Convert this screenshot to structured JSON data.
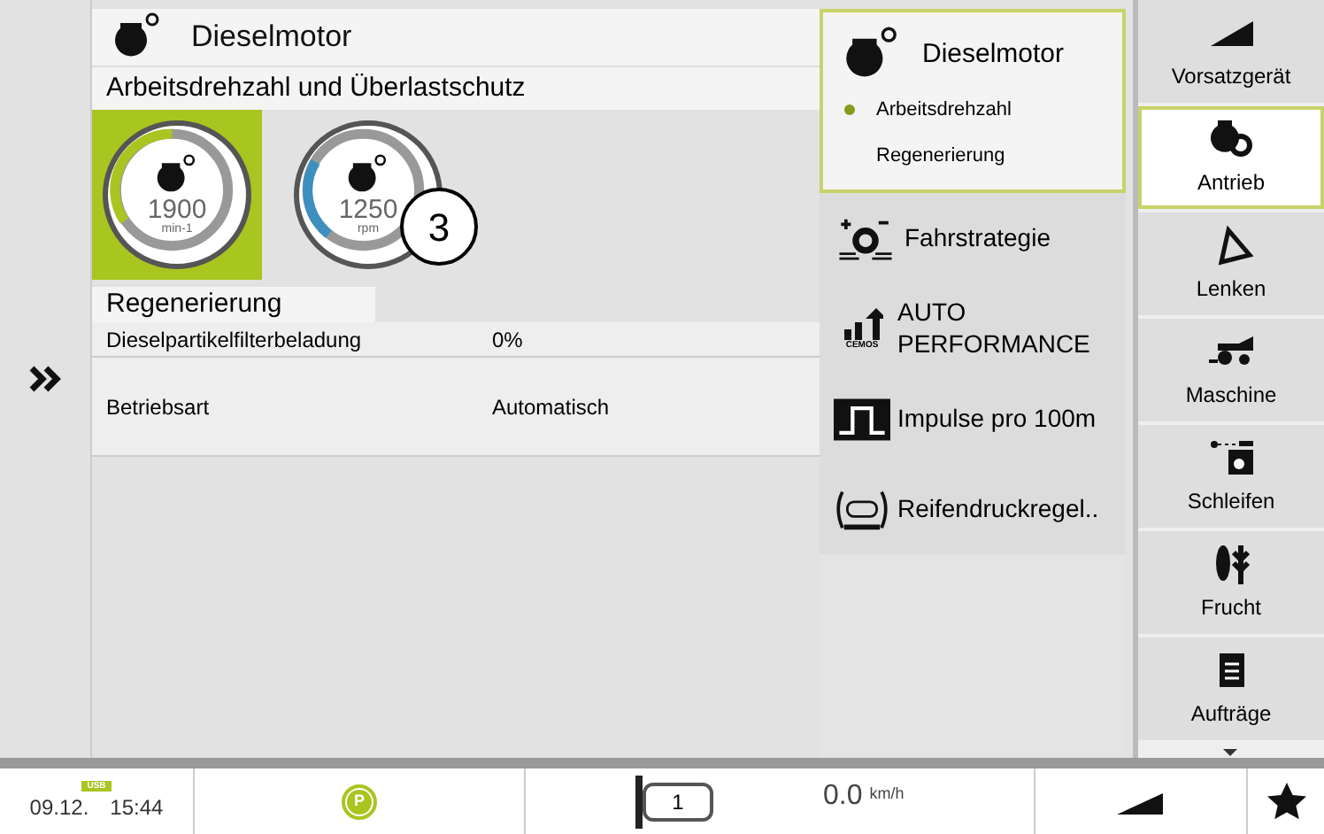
{
  "header": {
    "title": "Dieselmotor"
  },
  "section": {
    "title": "Arbeitsdrehzahl und Überlastschutz"
  },
  "dials": [
    {
      "kind": "work",
      "value": "1900",
      "unit": "min-1",
      "selected": true
    },
    {
      "kind": "overload",
      "value": "1250",
      "unit": "rpm",
      "selected": false
    }
  ],
  "callout": "3",
  "regeneration": {
    "title": "Regenerierung",
    "rows": [
      {
        "label": "Dieselpartikelfilterbeladung",
        "value": "0%",
        "kind": "short"
      },
      {
        "label": "Betriebsart",
        "value": "Automatisch",
        "kind": "tall"
      }
    ]
  },
  "menu": [
    {
      "kind": "engine",
      "label": "Dieselmotor",
      "selected": true,
      "children": [
        {
          "label": "Arbeitsdrehzahl",
          "selected": true
        },
        {
          "label": "Regenerierung",
          "selected": false
        }
      ]
    },
    {
      "kind": "strategy",
      "label": "Fahrstrategie",
      "selected": false
    },
    {
      "kind": "performance",
      "label": "AUTO PERFORMANCE",
      "badge": "CEMOS",
      "selected": false
    },
    {
      "kind": "pulse",
      "label": "Impulse pro 100m",
      "selected": false
    },
    {
      "kind": "tire",
      "label": "Reifendruckregel..",
      "selected": false
    }
  ],
  "tabs": [
    {
      "kind": "header",
      "label": "Vorsatzgerät",
      "selected": false
    },
    {
      "kind": "drive",
      "label": "Antrieb",
      "selected": true
    },
    {
      "kind": "steer",
      "label": "Lenken",
      "selected": false
    },
    {
      "kind": "machine",
      "label": "Maschine",
      "selected": false
    },
    {
      "kind": "loops",
      "label": "Schleifen",
      "selected": false
    },
    {
      "kind": "crop",
      "label": "Frucht",
      "selected": false
    },
    {
      "kind": "orders",
      "label": "Aufträge",
      "selected": false
    }
  ],
  "status_bar": {
    "usb": "USB",
    "date": "09.12.",
    "time": "15:44",
    "parking": "P",
    "track": "1",
    "speed": "0.0",
    "speed_unit": "km/h"
  }
}
